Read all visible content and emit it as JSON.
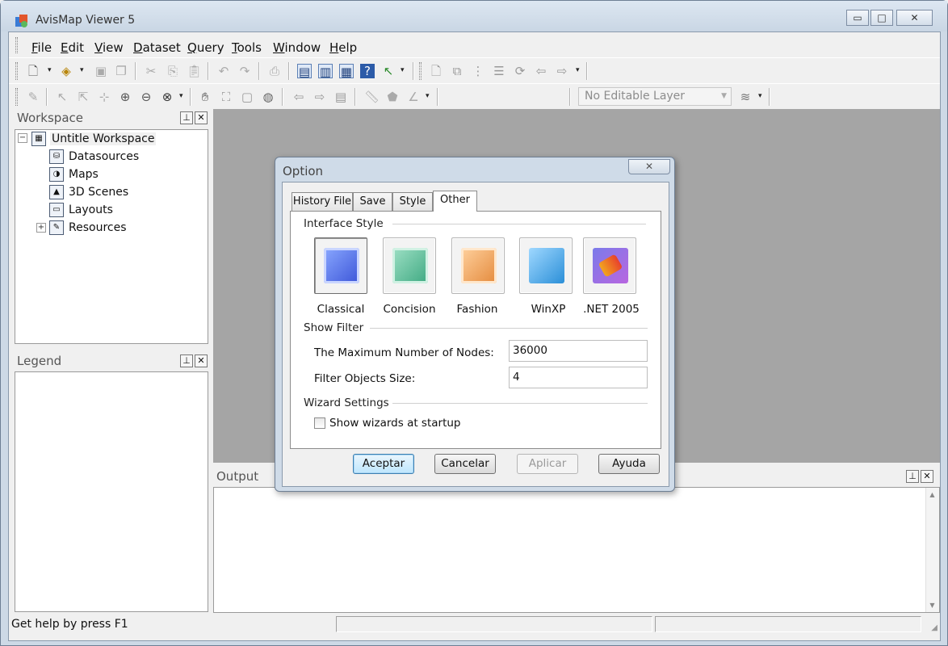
{
  "window": {
    "title": "AvisMap Viewer 5",
    "controls": {
      "minimize": "▭",
      "maximize": "□",
      "close": "✕"
    }
  },
  "menubar": {
    "items": [
      {
        "label": "File",
        "key": "F",
        "rest": "ile"
      },
      {
        "label": "Edit",
        "key": "E",
        "rest": "dit"
      },
      {
        "label": "View",
        "key": "V",
        "rest": "iew"
      },
      {
        "label": "Dataset",
        "key": "D",
        "rest": "ataset"
      },
      {
        "label": "Query",
        "key": "Q",
        "rest": "uery"
      },
      {
        "label": "Tools",
        "key": "T",
        "rest": "ools"
      },
      {
        "label": "Window",
        "key": "W",
        "rest": "indow"
      },
      {
        "label": "Help",
        "key": "H",
        "rest": "elp"
      }
    ]
  },
  "toolbar": {
    "layer_combo": "No Editable Layer"
  },
  "workspace": {
    "title": "Workspace",
    "root": "Untitle Workspace",
    "items": [
      "Datasources",
      "Maps",
      "3D Scenes",
      "Layouts",
      "Resources"
    ]
  },
  "legend": {
    "title": "Legend"
  },
  "output": {
    "title": "Output"
  },
  "panel_buttons": {
    "pin": "ᴘ",
    "close": "✕"
  },
  "status": {
    "text": "Get help by press F1"
  },
  "dialog": {
    "title": "Option",
    "close": "✕",
    "tabs": [
      "History File",
      "Save",
      "Style",
      "Other"
    ],
    "active_tab": "Other",
    "interface_style": {
      "heading": "Interface Style",
      "options": [
        "Classical",
        "Concision",
        "Fashion",
        "WinXP",
        ".NET 2005"
      ],
      "selected": "Classical"
    },
    "show_filter": {
      "heading": "Show Filter",
      "max_nodes_label": "The Maximum Number of Nodes:",
      "max_nodes_value": "36000",
      "filter_size_label": "Filter Objects Size:",
      "filter_size_value": "4"
    },
    "wizard": {
      "heading": "Wizard Settings",
      "checkbox_label": "Show wizards at startup",
      "checked": false
    },
    "buttons": {
      "ok": "Aceptar",
      "cancel": "Cancelar",
      "apply": "Aplicar",
      "help": "Ayuda"
    }
  }
}
